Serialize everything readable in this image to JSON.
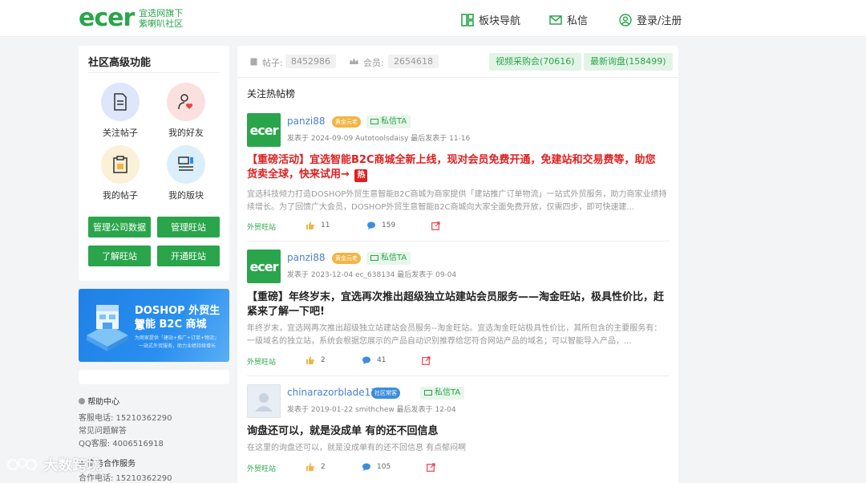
{
  "header": {
    "logo_text": "ecer",
    "logo_sub_1": "宜选网旗下",
    "logo_sub_2": "紫喇叭社区",
    "nav_forum": "板块导航",
    "nav_messages": "私信",
    "nav_login": "登录/注册"
  },
  "advanced": {
    "title": "社区高级功能",
    "features": [
      {
        "label": "关注帖子",
        "icon": "document-icon"
      },
      {
        "label": "我的好友",
        "icon": "friend-heart-icon"
      },
      {
        "label": "我的帖子",
        "icon": "clipboard-icon"
      },
      {
        "label": "我的版块",
        "icon": "board-icon"
      }
    ],
    "buttons": [
      "管理公司数据",
      "管理旺站",
      "了解旺站",
      "开通旺站"
    ]
  },
  "banner": {
    "line1": "DOSHOP 外贸生意",
    "line2": "智能 B2C 商城",
    "line3": "为商家提供「建站+推广+订单+物流」",
    "line4": "一站式外贸服务，助力业绩持续增长"
  },
  "help": {
    "title": "帮助中心",
    "phone": "客服电话: 15210362290",
    "faq": "常见问题解答",
    "qq": "QQ客服: 4006516918",
    "coop_title": "商务合作服务",
    "coop_phone": "合作电话: 15210362290"
  },
  "stats": {
    "posts_label": "帖子:",
    "posts_value": "8452986",
    "members_label": "会员:",
    "members_value": "2654618",
    "video_btn": "视频采购会(70616)",
    "inquiry_btn": "最新询盘(158499)"
  },
  "section_title": "关注热帖榜",
  "posts": [
    {
      "username": "panzi88",
      "badge": "黄金元老",
      "pm": "私信TA",
      "meta": "发表于 2024-09-09    Autotoolsdaisy 最后发表于 11-16",
      "title": "【重磅活动】宜选智能B2C商城全新上线，现对会员免费开通，免建站和交易费等，助您货卖全球，快来试用→",
      "hot": "热",
      "desc": "宜选科技倾力打造DOSHOP外贸生意智能B2C商城为商家提供「建站推广订单物流」一站式外贸服务，助力商家业绩持续增长。为了回馈广大会员，DOSHOP外贸生意智能B2C商城向大家全面免费开放，仅需四步，即可快速建...",
      "category": "外贸旺站",
      "likes": "11",
      "comments": "159"
    },
    {
      "username": "panzi88",
      "badge": "黄金元老",
      "pm": "私信TA",
      "meta": "发表于 2023-12-04    ec_638134 最后发表于 09-04",
      "title": "【重磅】年终岁末，宜选再次推出超级独立站建站会员服务——淘金旺站，极具性价比，赶紧来了解一下吧!",
      "desc": "年终岁末，宜选网再次推出超级独立站建站会员服务--淘金旺站。宜选淘金旺站极具性价比，其所包含的主要服务有：一级域名的独立站，系统会根据您展示的产品自动识别推荐给您符合网站产品的域名；可以智能导入产品，...",
      "category": "外贸旺站",
      "likes": "2",
      "comments": "41"
    },
    {
      "username": "chinarazorblade137",
      "badge": "社区常客",
      "pm": "私信TA",
      "meta": "发表于 2019-01-22    smithchew 最后发表于 12-04",
      "title": "询盘还可以，就是没成单 有的还不回信息",
      "desc": "在这里的询盘还可以，就是没成单有的还不回信息 有点郁闷啊",
      "category": "外贸旺站",
      "likes": "2",
      "comments": "105"
    }
  ],
  "watermark": "大数跨境",
  "colors": {
    "brand_green": "#2aa54b",
    "hot_red": "#e02020",
    "link_blue": "#4a7fd0"
  }
}
